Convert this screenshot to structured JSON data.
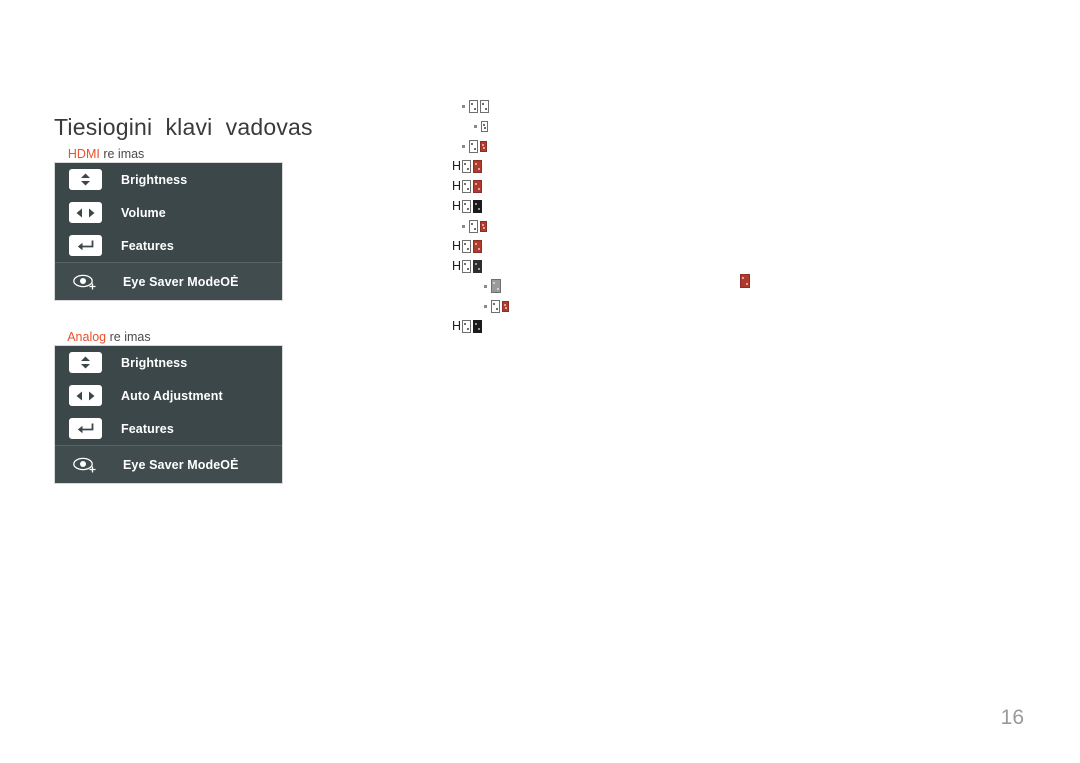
{
  "document": {
    "title": "Tiesiogini  klavi  vadovas",
    "page_number": "16",
    "accent_color": "#e8512b",
    "panel_color": "#3c4749",
    "page_number_color": "#9a9a9a"
  },
  "sections": [
    {
      "id": "hdmi",
      "label_accent": "HDMI",
      "label_rest": " re imas",
      "panel": {
        "rows": [
          {
            "icon": "up-down-arrows-icon",
            "label": "Brightness"
          },
          {
            "icon": "left-right-arrows-icon",
            "label": "Volume"
          },
          {
            "icon": "enter-return-icon",
            "label": "Features"
          }
        ],
        "footer_row": {
          "icon": "eye-plus-icon",
          "label": "Eye Saver ModeOĖ"
        }
      }
    },
    {
      "id": "analog",
      "label_accent": "Analog",
      "label_rest": " re imas",
      "panel": {
        "rows": [
          {
            "icon": "up-down-arrows-icon",
            "label": "Brightness"
          },
          {
            "icon": "left-right-arrows-icon",
            "label": "Auto Adjustment"
          },
          {
            "icon": "enter-return-icon",
            "label": "Features"
          }
        ],
        "footer_row": {
          "icon": "eye-plus-icon",
          "label": "Eye Saver ModeOĖ"
        }
      }
    }
  ],
  "glyph_column": {
    "lines": [
      {
        "indent": 1,
        "lead": "",
        "boxes": [
          "grey-md",
          "grey-md"
        ]
      },
      {
        "indent": 2,
        "lead": "",
        "boxes": [
          "grey-sm"
        ]
      },
      {
        "indent": 1,
        "lead": "",
        "boxes": [
          "grey-md",
          "red-sm"
        ]
      },
      {
        "indent": 0,
        "lead": "H",
        "boxes": [
          "grey-md",
          "red-md"
        ]
      },
      {
        "indent": 0,
        "lead": "H",
        "boxes": [
          "grey-md",
          "red-md"
        ]
      },
      {
        "indent": 0,
        "lead": "H",
        "boxes": [
          "grey-md",
          "deep-md"
        ]
      },
      {
        "indent": 1,
        "lead": "",
        "boxes": [
          "grey-md",
          "red-sm"
        ]
      },
      {
        "indent": 0,
        "lead": "H",
        "boxes": [
          "grey-md",
          "red-md"
        ]
      },
      {
        "indent": 0,
        "lead": "H",
        "boxes": [
          "grey-md",
          "dark-md"
        ]
      },
      {
        "indent": 3,
        "lead": "",
        "boxes": [
          "mut-lg"
        ]
      },
      {
        "indent": 3,
        "lead": "",
        "boxes": [
          "grey-md",
          "red-sm"
        ]
      },
      {
        "indent": 0,
        "lead": "H",
        "boxes": [
          "grey-md",
          "deep-md"
        ]
      }
    ],
    "stray_glyph": "red-lg"
  }
}
